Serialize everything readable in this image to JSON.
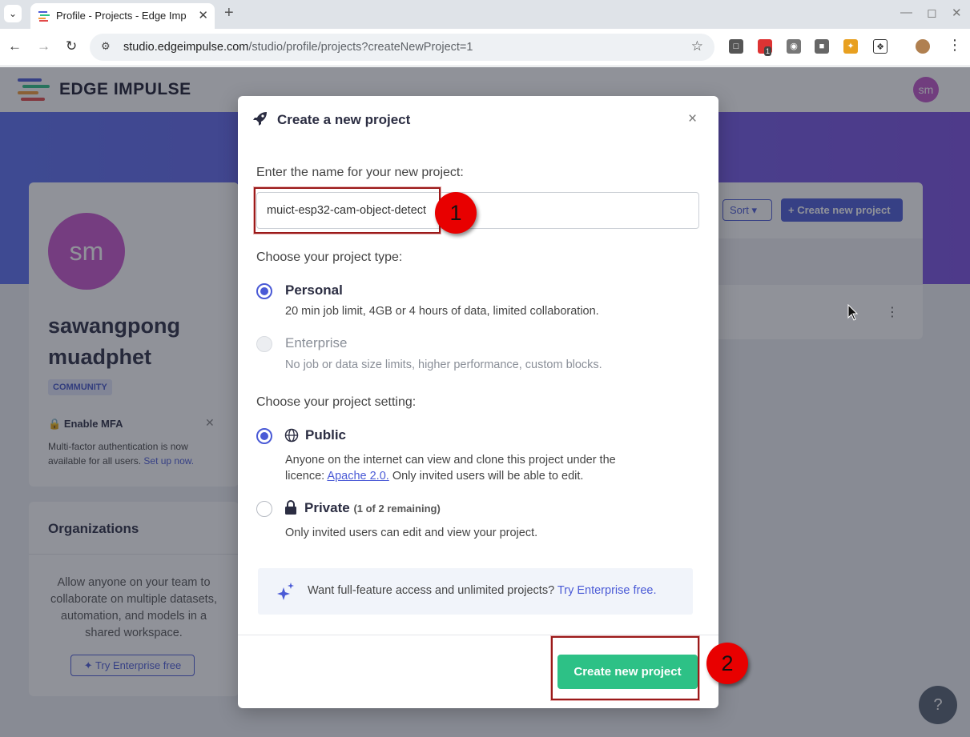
{
  "browser": {
    "tab_title": "Profile - Projects - Edge Imp",
    "url_domain": "studio.edgeimpulse.com",
    "url_path": "/studio/profile/projects?createNewProject=1",
    "ext_badge": "1"
  },
  "site": {
    "logo_text": "EDGE IMPULSE",
    "header_avatar": "sm"
  },
  "profile": {
    "avatar_initials": "sm",
    "name": "sawangpong muadphet",
    "badge": "COMMUNITY",
    "mfa_title": "Enable MFA",
    "mfa_text": "Multi-factor authentication is now available for all users.",
    "mfa_link": "Set up now."
  },
  "organizations": {
    "title": "Organizations",
    "text": "Allow anyone on your team to collaborate on multiple datasets, automation, and models in a shared workspace.",
    "button": "Try Enterprise free"
  },
  "projects": {
    "sort_label": "Sort",
    "create_label": "Create new project"
  },
  "modal": {
    "title": "Create a new project",
    "name_label": "Enter the name for your new project:",
    "name_value": "muict-esp32-cam-object-detect",
    "type_label": "Choose your project type:",
    "types": [
      {
        "title": "Personal",
        "desc": "20 min job limit, 4GB or 4 hours of data, limited collaboration.",
        "selected": true,
        "disabled": false
      },
      {
        "title": "Enterprise",
        "desc": "No job or data size limits, higher performance, custom blocks.",
        "selected": false,
        "disabled": true
      }
    ],
    "setting_label": "Choose your project setting:",
    "public": {
      "title": "Public",
      "desc_1": "Anyone on the internet can view and clone this project under the licence:",
      "licence_link": "Apache 2.0.",
      "desc_2": "Only invited users will be able to edit.",
      "selected": true
    },
    "private": {
      "title": "Private",
      "note": "(1 of 2 remaining)",
      "desc": "Only invited users can edit and view your project.",
      "selected": false
    },
    "promo_text": "Want full-feature access and unlimited projects?",
    "promo_link": "Try Enterprise free.",
    "submit_label": "Create new project"
  },
  "annotations": {
    "step_1": "1",
    "step_2": "2",
    "color": "#e80000"
  },
  "colors": {
    "accent": "#4a5ad6",
    "success": "#2dc186",
    "avatar": "#c955cc"
  }
}
